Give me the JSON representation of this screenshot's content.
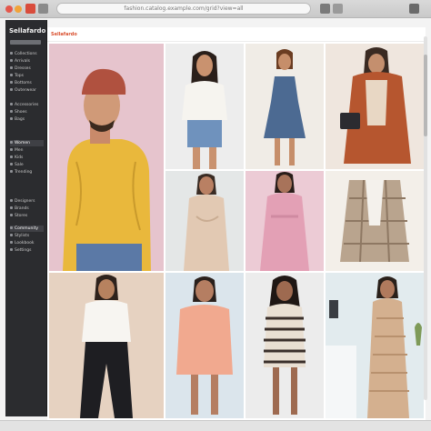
{
  "browser": {
    "url": "fashion.catalog.example.com/grid?view=all"
  },
  "sidebar": {
    "logo": "Sellafardo",
    "sections": [
      {
        "items": [
          "Collections",
          "Arrivals",
          "Dresses",
          "Tops",
          "Bottoms",
          "Outerwear"
        ]
      },
      {
        "items": [
          "Accessories",
          "Shoes",
          "Bags"
        ]
      },
      {
        "items": [
          "Women",
          "Men",
          "Kids",
          "Sale",
          "Trending"
        ]
      },
      {
        "items": [
          "Designers",
          "Brands",
          "Stores"
        ]
      },
      {
        "items": [
          "Community",
          "Stylists",
          "Lookbook",
          "Settings"
        ]
      }
    ]
  },
  "main": {
    "brand": "Sellafardo"
  },
  "colors": {
    "sidebar_bg": "#2b2c2f",
    "accent": "#d9502f",
    "yellow_sweater": "#e9b83c",
    "pink_bg": "#e8c6cc",
    "denim": "#4c6a92"
  },
  "tiles": [
    {
      "name": "photo-man-yellow-sweater"
    },
    {
      "name": "photo-woman-white-blouse"
    },
    {
      "name": "photo-woman-denim-dress"
    },
    {
      "name": "photo-woman-rust-coat"
    },
    {
      "name": "photo-woman-beige-dress"
    },
    {
      "name": "photo-woman-pink-dress"
    },
    {
      "name": "photo-plaid-jacket"
    },
    {
      "name": "photo-woman-black-pants"
    },
    {
      "name": "photo-woman-pink-sweater"
    },
    {
      "name": "photo-woman-striped-dress"
    },
    {
      "name": "photo-woman-knit-dress"
    }
  ]
}
